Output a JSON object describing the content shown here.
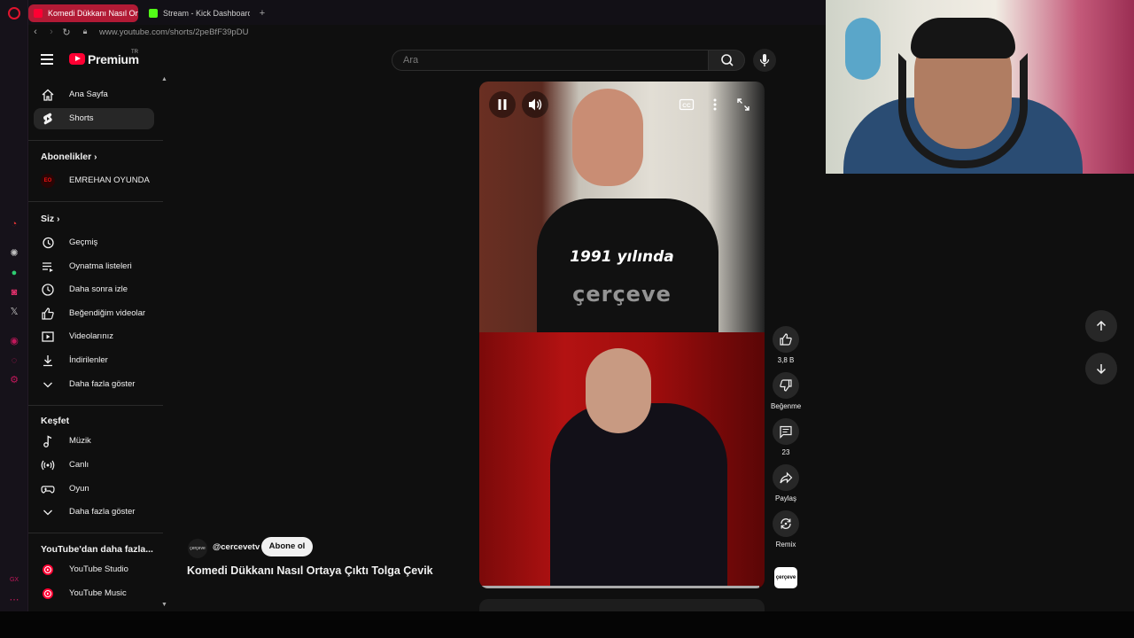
{
  "browser": {
    "tabs": [
      {
        "title": "Komedi Dükkanı Nasıl Ortaya Çıktı Tolga Çevik",
        "active": true,
        "color": "#ff0033"
      },
      {
        "title": "Stream - Kick Dashboard",
        "active": false,
        "color": "#53fc18"
      }
    ],
    "new_tab_icon": "plus-icon",
    "url": "www.youtube.com/shorts/2peBfF39pDU"
  },
  "masthead": {
    "brand": "Premium",
    "country": "TR",
    "search_placeholder": "Ara"
  },
  "sidebar": {
    "main": [
      {
        "label": "Ana Sayfa",
        "icon": "home-icon",
        "active": false
      },
      {
        "label": "Shorts",
        "icon": "shorts-icon",
        "active": true
      }
    ],
    "subscriptions_heading": "Abonelikler",
    "subscriptions": [
      {
        "label": "EMREHAN OYUNDA",
        "icon": "channel-avatar"
      }
    ],
    "you_heading": "Siz",
    "you": [
      {
        "label": "Geçmiş",
        "icon": "history-icon"
      },
      {
        "label": "Oynatma listeleri",
        "icon": "playlist-icon"
      },
      {
        "label": "Daha sonra izle",
        "icon": "clock-icon"
      },
      {
        "label": "Beğendiğim videolar",
        "icon": "thumb-up-icon"
      },
      {
        "label": "Videolarınız",
        "icon": "video-icon"
      },
      {
        "label": "İndirilenler",
        "icon": "download-icon"
      },
      {
        "label": "Daha fazla göster",
        "icon": "chevron-down-icon"
      }
    ],
    "explore_heading": "Keşfet",
    "explore": [
      {
        "label": "Müzik",
        "icon": "music-icon"
      },
      {
        "label": "Canlı",
        "icon": "live-icon"
      },
      {
        "label": "Oyun",
        "icon": "gaming-icon"
      },
      {
        "label": "Daha fazla göster",
        "icon": "chevron-down-icon"
      }
    ],
    "more_heading": "YouTube'dan daha fazla...",
    "more": [
      {
        "label": "YouTube Studio",
        "icon": "youtube-studio-icon"
      },
      {
        "label": "YouTube Music",
        "icon": "youtube-music-icon"
      }
    ]
  },
  "video": {
    "caption": "1991 yılında",
    "watermark": "çerçeve",
    "progress": 0.98
  },
  "actions": {
    "like_count": "3,8 B",
    "dislike_label": "Beğenme",
    "comment_count": "23",
    "share_label": "Paylaş",
    "remix_label": "Remix"
  },
  "meta": {
    "channel_avatar_text": "çerçeve",
    "handle": "@cercevetv",
    "subscribe_label": "Abone ol",
    "title": "Komedi Dükkanı Nasıl Ortaya Çıktı Tolga Çevik",
    "channel_thumb_text": "çerçeve"
  },
  "colors": {
    "accent": "#ff0033",
    "background": "#0f0f0f",
    "opera_tab": "#b21a35"
  }
}
